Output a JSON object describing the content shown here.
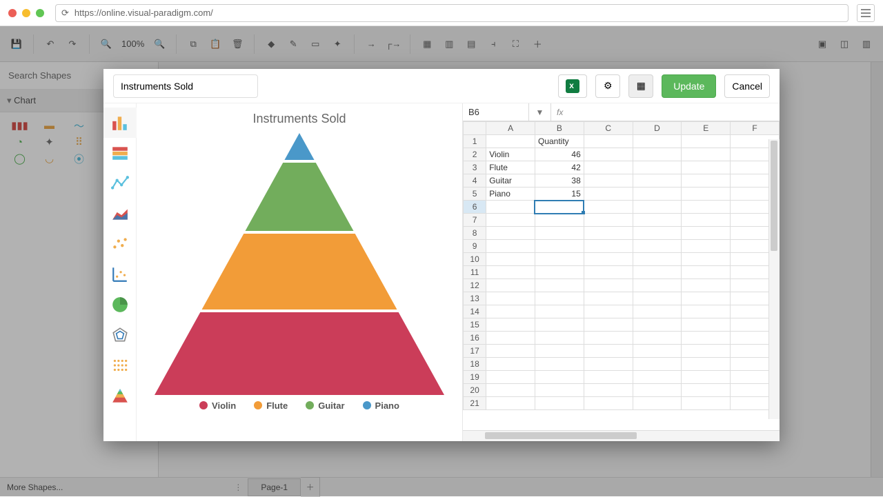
{
  "browser": {
    "url": "https://online.visual-paradigm.com/"
  },
  "toolbar": {
    "zoom": "100%"
  },
  "left_panel": {
    "search_placeholder": "Search Shapes",
    "category": "Chart",
    "more_shapes": "More Shapes..."
  },
  "bottom": {
    "page_tab": "Page-1"
  },
  "modal": {
    "title_value": "Instruments Sold",
    "update": "Update",
    "cancel": "Cancel"
  },
  "spreadsheet": {
    "cell_ref": "B6",
    "columns": [
      "A",
      "B",
      "C",
      "D",
      "E",
      "F"
    ],
    "header_row": [
      "",
      "Quantity"
    ],
    "rows": [
      {
        "n": 1,
        "a": "",
        "b": "Quantity",
        "b_is_header": true
      },
      {
        "n": 2,
        "a": "Violin",
        "b": 46
      },
      {
        "n": 3,
        "a": "Flute",
        "b": 42
      },
      {
        "n": 4,
        "a": "Guitar",
        "b": 38
      },
      {
        "n": 5,
        "a": "Piano",
        "b": 15
      }
    ],
    "total_rows": 21,
    "selected": "B6"
  },
  "chart_data": {
    "type": "pyramid",
    "title": "Instruments Sold",
    "series": [
      {
        "name": "Violin",
        "value": 46,
        "color": "#cb3d59"
      },
      {
        "name": "Flute",
        "value": 42,
        "color": "#f29c38"
      },
      {
        "name": "Guitar",
        "value": 38,
        "color": "#72ad5c"
      },
      {
        "name": "Piano",
        "value": 15,
        "color": "#4a98c9"
      }
    ],
    "legend_position": "bottom"
  }
}
